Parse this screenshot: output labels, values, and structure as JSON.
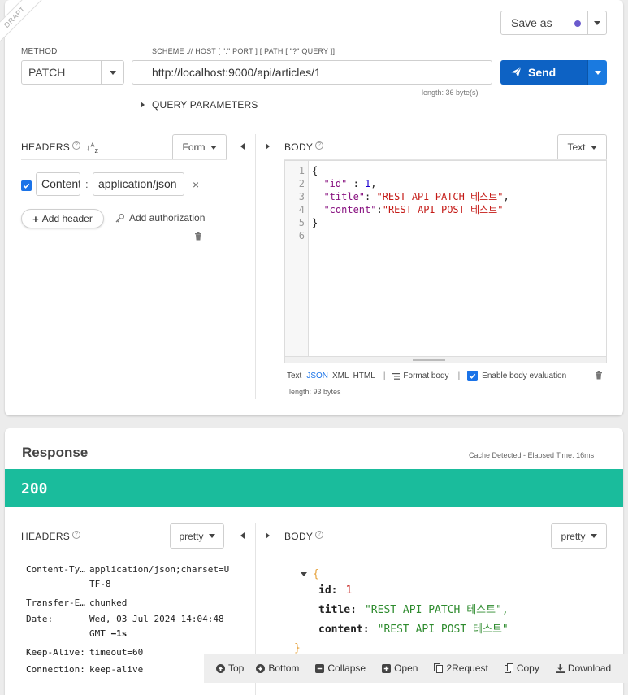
{
  "draft_badge": "DRAFT",
  "top_actions": {
    "save_label": "Save as",
    "dot_color": "#6a5acd"
  },
  "request": {
    "method_label": "METHOD",
    "method_value": "PATCH",
    "url_label": "SCHEME :// HOST [ \":\" PORT ] [ PATH [ \"?\" QUERY ]]",
    "url_value": "http://localhost:9000/api/articles/1",
    "url_length": "length: 36 byte(s)",
    "send_label": "Send",
    "query_params_label": "QUERY PARAMETERS"
  },
  "req_headers": {
    "title": "HEADERS",
    "form_label": "Form",
    "header_name": "Content-Type",
    "header_value": "application/json",
    "add_header_label": "Add header",
    "add_auth_label": "Add authorization"
  },
  "req_body": {
    "title": "BODY",
    "type_label": "Text",
    "line_numbers": [
      "1",
      "2",
      "3",
      "4",
      "5",
      "6"
    ],
    "lines": [
      [
        {
          "t": "{",
          "c": "p"
        }
      ],
      [
        {
          "t": "  ",
          "c": "p"
        },
        {
          "t": "\"id\"",
          "c": "k"
        },
        {
          "t": " : ",
          "c": "p"
        },
        {
          "t": "1",
          "c": "n"
        },
        {
          "t": ",",
          "c": "p"
        }
      ],
      [
        {
          "t": "  ",
          "c": "p"
        },
        {
          "t": "\"title\"",
          "c": "k"
        },
        {
          "t": ": ",
          "c": "p"
        },
        {
          "t": "\"REST API PATCH 테스트\"",
          "c": "s"
        },
        {
          "t": ",",
          "c": "p"
        }
      ],
      [
        {
          "t": "  ",
          "c": "p"
        },
        {
          "t": "\"content\"",
          "c": "k"
        },
        {
          "t": ":",
          "c": "p"
        },
        {
          "t": "\"REST API POST 테스트\"",
          "c": "s"
        }
      ],
      [
        {
          "t": "}",
          "c": "p"
        }
      ],
      []
    ],
    "formats": {
      "text": "Text",
      "json": "JSON",
      "xml": "XML",
      "html": "HTML"
    },
    "format_body_label": "Format body",
    "enable_eval_label": "Enable body evaluation",
    "length": "length: 93 bytes"
  },
  "response": {
    "title": "Response",
    "cache_info": "Cache Detected - Elapsed Time: 16ms",
    "status_code": "200",
    "status_color": "#1abc9c",
    "headers_title": "HEADERS",
    "headers_mode": "pretty",
    "body_title": "BODY",
    "body_mode": "pretty",
    "headers": [
      {
        "key": "Content-Ty…",
        "val": "application/json;charset=UTF-8"
      },
      {
        "key": "Transfer-E…",
        "val": "chunked"
      },
      {
        "key": "Date:",
        "val": "Wed, 03 Jul 2024 14:04:48 GMT ",
        "extra": "−1s"
      },
      {
        "key": "Keep-Alive:",
        "val": "timeout=60"
      },
      {
        "key": "Connection:",
        "val": "keep-alive"
      }
    ],
    "body": {
      "open": "{",
      "close": "}",
      "fields": [
        {
          "key": "id:",
          "val": "1",
          "type": "num"
        },
        {
          "key": "title:",
          "val": "\"REST API PATCH 테스트\",",
          "type": "str"
        },
        {
          "key": "content:",
          "val": "\"REST API POST 테스트\"",
          "type": "str"
        }
      ]
    }
  },
  "bottom_toolbar": {
    "top": "Top",
    "bottom": "Bottom",
    "collapse": "Collapse",
    "open": "Open",
    "to_request": "2Request",
    "copy": "Copy",
    "download": "Download"
  }
}
